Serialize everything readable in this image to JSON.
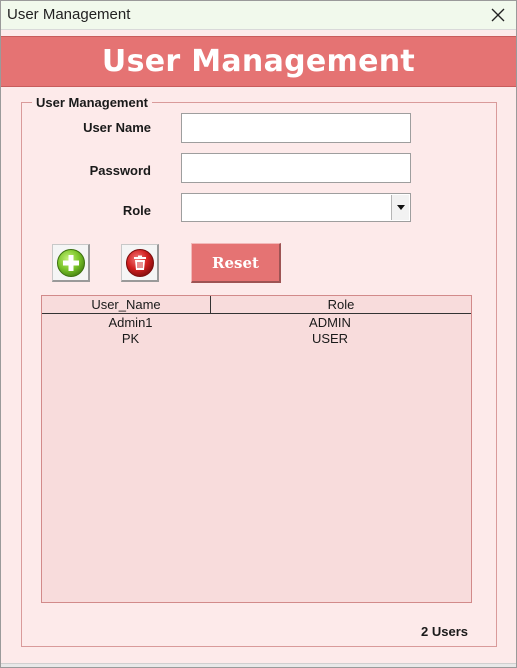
{
  "window": {
    "title": "User Management",
    "close_icon": "close-icon"
  },
  "banner": {
    "title": "User Management"
  },
  "form": {
    "group_title": "User Management",
    "username_label": "User Name",
    "username_value": "",
    "password_label": "Password",
    "password_value": "",
    "role_label": "Role",
    "role_value": ""
  },
  "toolbar": {
    "add_icon": "add-icon",
    "delete_icon": "delete-icon",
    "reset_label": "Reset"
  },
  "users_list": {
    "columns": [
      "User_Name",
      "Role"
    ],
    "rows": [
      {
        "user_name": "Admin1",
        "role": "ADMIN"
      },
      {
        "user_name": "PK",
        "role": "USER"
      }
    ]
  },
  "status": {
    "count_text": "2 Users"
  },
  "colors": {
    "accent": "#e57373",
    "background": "#fdeaea",
    "list_background": "#f8dcdc",
    "titlebar": "#f1f9ec"
  }
}
